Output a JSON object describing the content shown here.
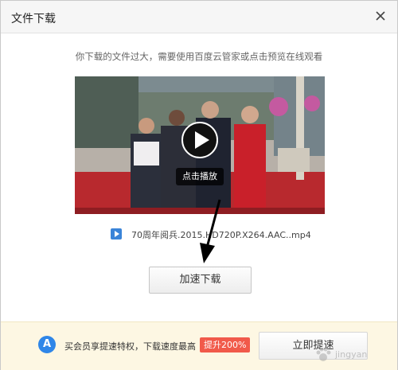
{
  "dialog": {
    "title": "文件下载"
  },
  "notice": "你下载的文件过大，需要使用百度云管家或点击预览在线观看",
  "video": {
    "play_label": "点击播放"
  },
  "file": {
    "name": "70周年阅兵.2015.HD720P.X264.AAC..mp4"
  },
  "buttons": {
    "download": "加速下载",
    "upgrade": "立即提速"
  },
  "footer": {
    "promo": "买会员享提速特权，下载速度最高",
    "boost_badge": "提升200%"
  },
  "watermark": {
    "text": "jingyan"
  },
  "colors": {
    "accent": "#2f86e8",
    "badge": "#f15a4a",
    "footer_bg": "#fdf7e3"
  }
}
